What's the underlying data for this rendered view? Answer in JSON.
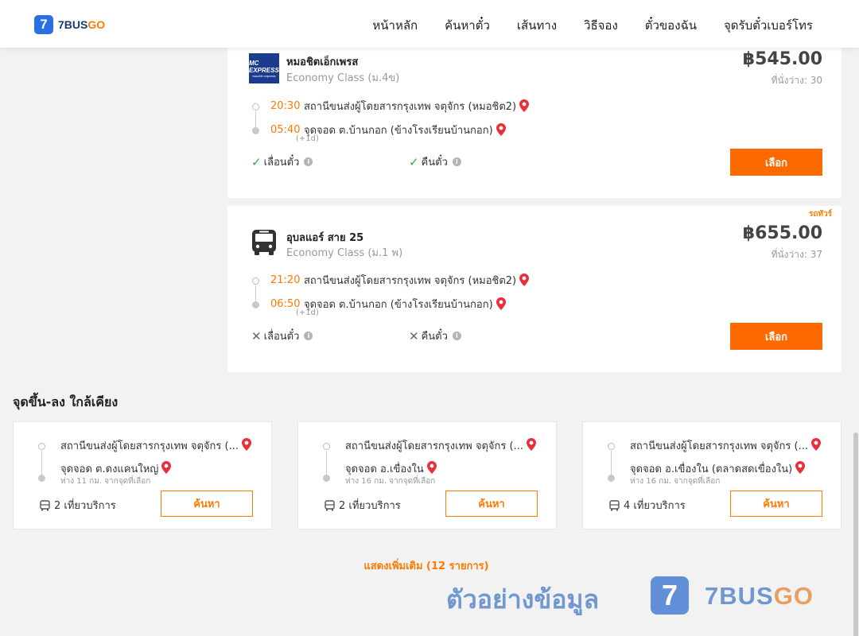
{
  "brand": {
    "badge": "7",
    "name_main": "7BUS",
    "name_accent": "GO",
    "accent_color": "#ff7a00",
    "primary_color": "#2a6fe8"
  },
  "nav": [
    "หน้าหลัก",
    "ค้นหาตั๋ว",
    "เส้นทาง",
    "วิธีจอง",
    "ตั๋วของฉัน",
    "จุดรับตั๋วเบอร์โทร"
  ],
  "trips": [
    {
      "operator": "หมอชิตเอ็กเพรส",
      "logo_line1": "MC EXPRESS",
      "logo_line2": "mochit express",
      "class": "Economy Class (ม.4ข)",
      "price": "฿545.00",
      "seats": "ที่นั่งว่าง: 30",
      "depart_time": "20:30",
      "depart_place": "สถานีขนส่งผู้โดยสารกรุงเทพ จตุจักร (หมอชิต2)",
      "arrive_time": "05:40",
      "arrive_place": "จุดจอด ต.บ้านกอก (ข้างโรงเรียนบ้านกอก)",
      "next_day": "(+1d)",
      "change_label": "เลื่อนตั๋ว",
      "refund_label": "คืนตั๋ว",
      "change_allowed": true,
      "refund_allowed": true,
      "select_label": "เลือก"
    },
    {
      "tag": "รถทัวร์",
      "operator": "อุบลแอร์ สาย 25",
      "class": "Economy Class (ม.1 พ)",
      "price": "฿655.00",
      "seats": "ที่นั่งว่าง: 37",
      "depart_time": "21:20",
      "depart_place": "สถานีขนส่งผู้โดยสารกรุงเทพ จตุจักร (หมอชิต2)",
      "arrive_time": "06:50",
      "arrive_place": "จุดจอด ต.บ้านกอก (ข้างโรงเรียนบ้านกอก)",
      "next_day": "(+1d)",
      "change_label": "เลื่อนตั๋ว",
      "refund_label": "คืนตั๋ว",
      "change_allowed": false,
      "refund_allowed": false,
      "select_label": "เลือก"
    }
  ],
  "nearby": {
    "title": "จุดขึ้น-ลง ใกล้เคียง",
    "items": [
      {
        "from": "สถานีขนส่งผู้โดยสารกรุงเทพ จตุจักร (...",
        "to": "จุดจอด ต.ดงแคนใหญ่",
        "distance": "ห่าง 11 กม. จากจุดที่เลือก",
        "trips": "2 เที่ยวบริการ",
        "search_label": "ค้นหา"
      },
      {
        "from": "สถานีขนส่งผู้โดยสารกรุงเทพ จตุจักร (...",
        "to": "จุดจอด อ.เขื่องใน",
        "distance": "ห่าง 16 กม. จากจุดที่เลือก",
        "trips": "2 เที่ยวบริการ",
        "search_label": "ค้นหา"
      },
      {
        "from": "สถานีขนส่งผู้โดยสารกรุงเทพ จตุจักร (...",
        "to": "จุดจอด อ.เขื่องใน (ตลาดสดเขื่องใน)",
        "distance": "ห่าง 16 กม. จากจุดที่เลือก",
        "trips": "4 เที่ยวบริการ",
        "search_label": "ค้นหา"
      }
    ]
  },
  "show_more": "แสดงเพิ่มเติม (12 รายการ)",
  "watermark": {
    "text": "ตัวอย่างข้อมูล",
    "badge": "7",
    "logo_main": "7BUS",
    "logo_accent": "GO"
  }
}
